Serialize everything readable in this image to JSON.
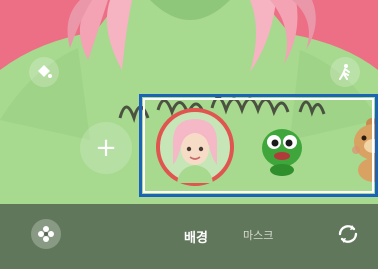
{
  "app": {
    "tabs": [
      {
        "label": "배경",
        "active": true
      },
      {
        "label": "마스크",
        "active": false
      }
    ]
  },
  "icons": {
    "top_left": "paint-bucket-icon",
    "top_right": "walking-figure-icon",
    "add": "plus-icon",
    "bottom_left": "flower-icon",
    "bottom_right": "switch-camera-icon"
  },
  "add_label": "+",
  "stickers": [
    {
      "name": "ar-emoji-avatar",
      "selected": true
    },
    {
      "name": "green-character",
      "selected": false
    },
    {
      "name": "bear-character",
      "selected": false
    }
  ],
  "colors": {
    "background_pink": "#ed6f86",
    "shirt_green": "#a7d98f",
    "selection_ring": "#e0554f",
    "highlight_blue": "#1b63b8"
  }
}
